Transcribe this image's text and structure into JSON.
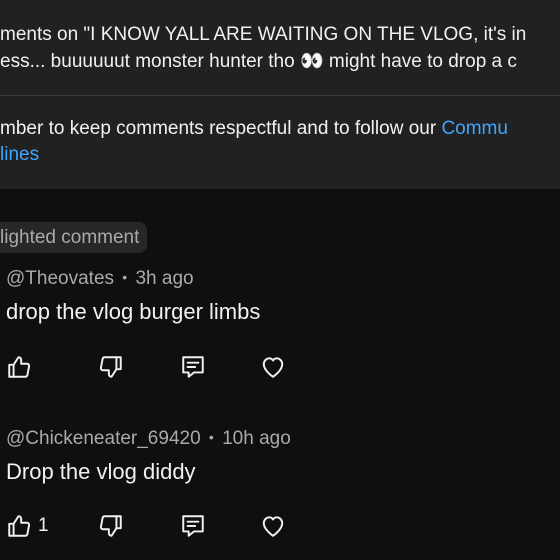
{
  "header": {
    "line1": "ments on \"I KNOW YALL ARE WAITING ON THE VLOG, it's in",
    "line2": "ess... buuuuuut monster hunter tho 👀 might have to drop a c"
  },
  "notice": {
    "line1_text": "mber to keep comments respectful and to follow our ",
    "line1_link": "Commu",
    "line2_link": "lines"
  },
  "highlight_label": "lighted comment",
  "comments": [
    {
      "author": "@Theovates",
      "separator": "•",
      "time": "3h ago",
      "text": "drop the vlog burger limbs",
      "like_count": ""
    },
    {
      "author": "@Chickeneater_69420",
      "separator": "•",
      "time": "10h ago",
      "text": "Drop the vlog diddy",
      "like_count": "1"
    }
  ],
  "icons": {
    "like": "thumbs-up-icon",
    "dislike": "thumbs-down-icon",
    "reply": "reply-comment-icon",
    "heart": "heart-icon"
  }
}
